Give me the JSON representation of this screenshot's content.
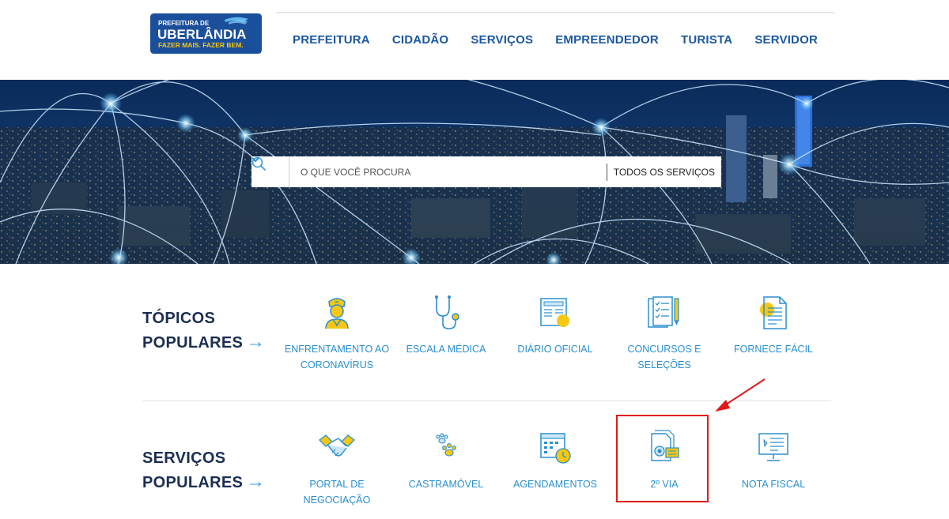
{
  "header": {
    "logo": {
      "line1": "PREFEITURA DE",
      "line2": "UBERLÂNDIA",
      "line3": "FAZER MAIS. FAZER BEM."
    },
    "nav": [
      {
        "label": "PREFEITURA"
      },
      {
        "label": "CIDADÃO"
      },
      {
        "label": "SERVIÇOS"
      },
      {
        "label": "EMPREENDEDOR"
      },
      {
        "label": "TURISTA"
      },
      {
        "label": "SERVIDOR"
      }
    ]
  },
  "search": {
    "placeholder": "O QUE VOCÊ PROCURA",
    "filter_label": "TODOS OS SERVIÇOS"
  },
  "topics": {
    "title_line1": "TÓPICOS",
    "title_line2": "POPULARES",
    "arrow": "→",
    "items": [
      {
        "label": "ENFRENTAMENTO AO CORONAVÍRUS",
        "icon": "doctor-icon"
      },
      {
        "label": "ESCALA MÉDICA",
        "icon": "stethoscope-icon"
      },
      {
        "label": "DIÁRIO OFICIAL",
        "icon": "newspaper-icon"
      },
      {
        "label": "CONCURSOS E SELEÇÕES",
        "icon": "checklist-icon"
      },
      {
        "label": "FORNECE FÁCIL",
        "icon": "document-icon"
      }
    ]
  },
  "services": {
    "title_line1": "SERVIÇOS",
    "title_line2": "POPULARES",
    "arrow": "→",
    "items": [
      {
        "label": "PORTAL DE NEGOCIAÇÃO",
        "icon": "handshake-icon"
      },
      {
        "label": "CASTRAMÓVEL",
        "icon": "paw-icon"
      },
      {
        "label": "AGENDAMENTOS",
        "icon": "calendar-icon"
      },
      {
        "label": "2º VIA",
        "icon": "document-copy-icon"
      },
      {
        "label": "NOTA FISCAL",
        "icon": "invoice-monitor-icon"
      }
    ]
  },
  "colors": {
    "brand_blue": "#1b57a0",
    "navy": "#1c2e52",
    "accent_blue": "#2a8fd0",
    "icon_yellow": "#f7c714",
    "annotation_red": "#e01b1b"
  }
}
